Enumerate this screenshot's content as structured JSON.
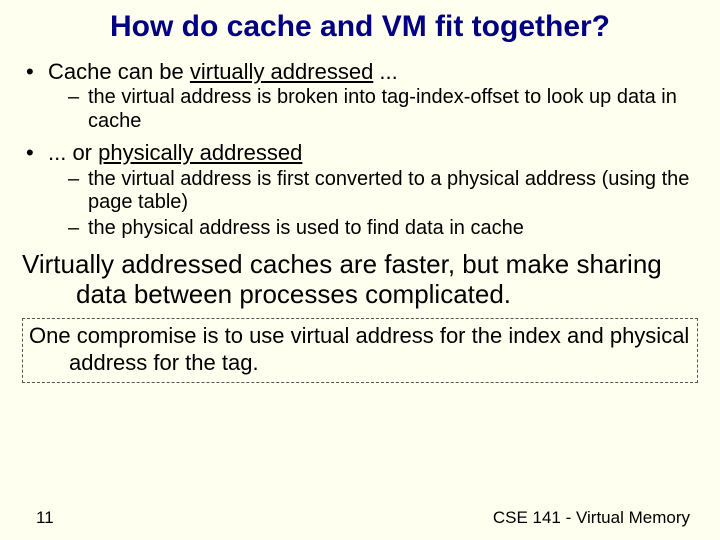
{
  "title": "How do cache and VM fit together?",
  "bullets": {
    "b1a_pre": "Cache can be ",
    "b1a_u": "virtually addressed",
    "b1a_post": " ...",
    "b1a_sub1": "the virtual address is broken into tag-index-offset to look up data in cache",
    "b1b_pre": "... or ",
    "b1b_u": "physically addressed",
    "b1b_sub1": "the virtual address is first converted to a physical address (using the page table)",
    "b1b_sub2": "the physical address is used to find data in cache"
  },
  "paragraph": "Virtually addressed caches are faster, but make sharing data between processes complicated.",
  "boxnote": "One compromise is to use virtual address for the index and physical address for the tag.",
  "footer": {
    "page": "11",
    "course": "CSE 141 - Virtual Memory"
  },
  "glyphs": {
    "dot": "•",
    "dash": "–"
  }
}
